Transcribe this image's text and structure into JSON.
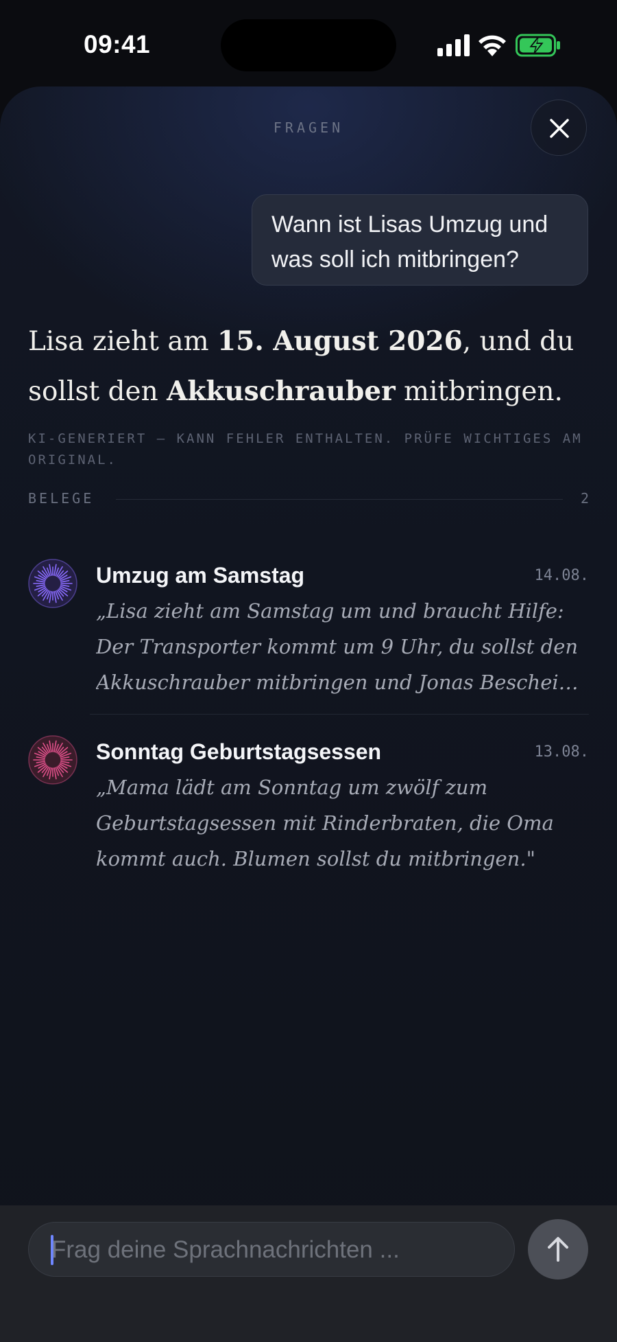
{
  "status_bar": {
    "time": "09:41"
  },
  "sheet": {
    "title": "FRAGEN",
    "close_icon": "close-icon",
    "question": "Wann ist Lisas Umzug und was soll ich mitbringen?",
    "answer": {
      "part1": "Lisa zieht am ",
      "date": "15. August 2026",
      "part2": ", und du sollst den ",
      "item": "Akkuschrauber",
      "part3": " mitbringen."
    },
    "disclaimer": "KI-GENERIERT — KANN FEHLER ENTHALTEN. PRÜFE WICHTIGES AM ORIGINAL.",
    "belege": {
      "label": "BELEGE",
      "count": "2",
      "items": [
        {
          "title": "Umzug am Samstag",
          "date": "14.08.",
          "quote": "„Lisa zieht am Samstag um und braucht Hilfe: Der Transporter kommt um 9 Uhr, du sollst den Akkuschrauber mitbringen und Jonas Bescheid geben.",
          "icon": "sunburst-icon",
          "color": "#8a6cff"
        },
        {
          "title": "Sonntag Geburtstagsessen",
          "date": "13.08.",
          "quote": "„Mama lädt am Sonntag um zwölf zum Geburtstagsessen mit Rinderbraten, die Oma kommt auch. Blumen sollst du mitbringen.\"",
          "icon": "sunburst-icon",
          "color": "#e0508a"
        }
      ]
    }
  },
  "composer": {
    "placeholder": "Frag deine Sprachnachrichten ...",
    "send_icon": "arrow-up-icon"
  },
  "colors": {
    "accent_caret": "#6f87ff",
    "battery_green": "#34c759"
  }
}
